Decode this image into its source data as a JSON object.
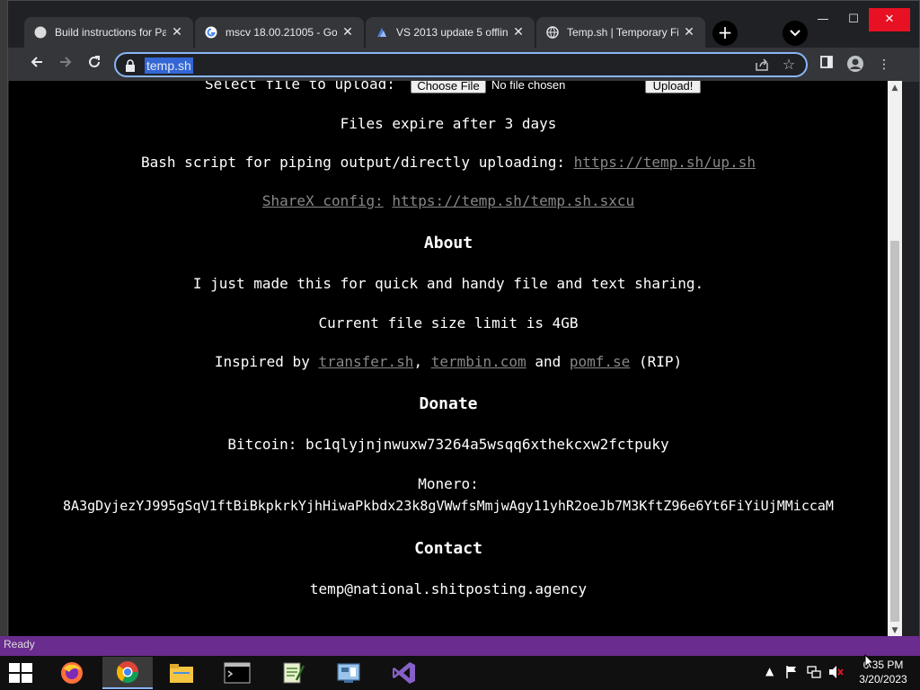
{
  "browser": {
    "tabs": [
      {
        "title": "Build instructions for Pa",
        "favicon": "globe-icon",
        "active": false
      },
      {
        "title": "mscv 18.00.21005 - Goo",
        "favicon": "google-icon",
        "active": false
      },
      {
        "title": "VS 2013 update 5 offlin",
        "favicon": "vs-icon",
        "active": false
      },
      {
        "title": "Temp.sh | Temporary Fil",
        "favicon": "globe-icon",
        "active": true
      }
    ],
    "newtab_label": "+",
    "url": "temp.sh",
    "window_controls": {
      "minimize": "—",
      "maximize": "☐",
      "close": "✕"
    }
  },
  "page": {
    "upload": {
      "label": "Select file to upload:",
      "choose_button": "Choose File",
      "no_file_text": "No file chosen",
      "upload_button": "Upload!"
    },
    "expire_text": "Files expire after 3 days",
    "bash_text": "Bash script for piping output/directly uploading:",
    "bash_link": "https://temp.sh/up.sh",
    "sharex_label": "ShareX config:",
    "sharex_link": "https://temp.sh/temp.sh.sxcu",
    "about_heading": "About",
    "about_text": "I just made this for quick and handy file and text sharing.",
    "limit_text": "Current file size limit is 4GB",
    "inspired": {
      "prefix": "Inspired by",
      "link1": "transfer.sh",
      "sep1": ",",
      "link2": "termbin.com",
      "and": "and",
      "link3": "pomf.se",
      "suffix": "(RIP)"
    },
    "donate_heading": "Donate",
    "bitcoin_text": "Bitcoin: bc1qlyjnjnwuxw73264a5wsqq6xthekcxw2fctpuky",
    "monero_label": "Monero:",
    "monero_address": "8A3gDyjezYJ995gSqV1ftBiBkpkrkYjhHiwaPkbdx23k8gVWwfsMmjwAgy11yhR2oeJb7M3KftZ96e6Yt6FiYiUjMMiccaM",
    "contact_heading": "Contact",
    "contact_email": "temp@national.shitposting.agency"
  },
  "status_bar": {
    "text": "Ready"
  },
  "taskbar": {
    "apps": [
      "firefox-icon",
      "chrome-icon",
      "file-explorer-icon",
      "terminal-icon",
      "notepad-icon",
      "control-panel-icon",
      "visual-studio-icon"
    ],
    "clock_time": "6:35 PM",
    "clock_date": "3/20/2023"
  },
  "colors": {
    "page_bg": "#000000",
    "link": "#888888",
    "omnibox_focus": "#8ab4f8",
    "status_strip": "#6a2c8e",
    "close_red": "#e81123"
  }
}
